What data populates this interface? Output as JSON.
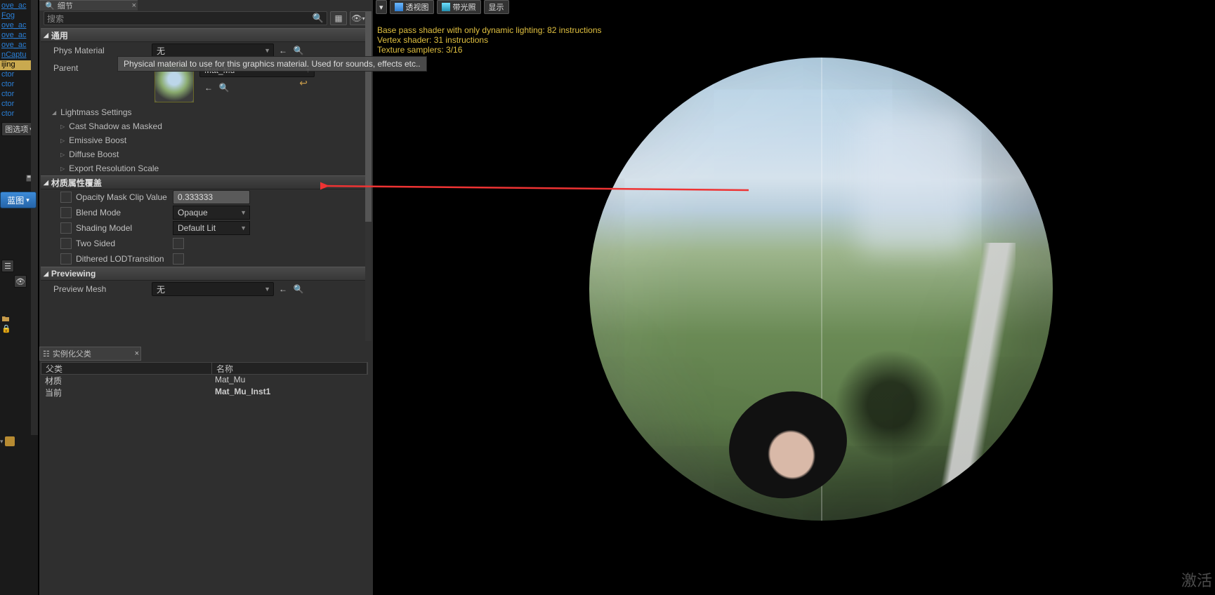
{
  "outliner": {
    "items": [
      "ove_ac",
      "Fog",
      "ove_ac",
      "ove_ac",
      "ove_ac",
      "nCaptu",
      "ijing",
      "ctor",
      "ctor",
      "ctor",
      "ctor",
      "ctor"
    ],
    "selected_index": 6,
    "view_options_label": "图选项"
  },
  "blueprint_btn": "蓝图",
  "details": {
    "tab_label": "细节",
    "search_placeholder": "搜索",
    "sections": {
      "general": {
        "label": "通用"
      },
      "lightmass": {
        "label": "Lightmass Settings",
        "children": [
          "Cast Shadow as Masked",
          "Emissive Boost",
          "Diffuse Boost",
          "Export Resolution Scale"
        ]
      },
      "overrides": {
        "label": "材质属性覆盖"
      },
      "previewing": {
        "label": "Previewing"
      }
    },
    "phys_material": {
      "label": "Phys Material",
      "value": "无"
    },
    "parent": {
      "label": "Parent",
      "asset": "Mat_Mu"
    },
    "overrides": {
      "opacity_mask": {
        "label": "Opacity Mask Clip Value",
        "value": "0.333333"
      },
      "blend_mode": {
        "label": "Blend Mode",
        "value": "Opaque"
      },
      "shading_model": {
        "label": "Shading Model",
        "value": "Default Lit"
      },
      "two_sided": {
        "label": "Two Sided"
      },
      "dithered_lod": {
        "label": "Dithered LODTransition"
      }
    },
    "preview_mesh": {
      "label": "Preview Mesh",
      "value": "无"
    }
  },
  "tooltip": "Physical material to use for this graphics material. Used for sounds, effects etc..",
  "parents_panel": {
    "tab": "实例化父类",
    "col1": "父类",
    "col2": "名称",
    "rows": [
      {
        "p": "材质",
        "n": "Mat_Mu"
      },
      {
        "p": "当前",
        "n": "Mat_Mu_Inst1"
      }
    ]
  },
  "viewport": {
    "buttons": {
      "perspective": "透视图",
      "lit": "带光照",
      "show": "显示"
    },
    "stats": {
      "l1": "Base pass shader with only dynamic lighting: 82 instructions",
      "l2": "Vertex shader: 31 instructions",
      "l3": "Texture samplers: 3/16"
    }
  },
  "watermark": "激活"
}
